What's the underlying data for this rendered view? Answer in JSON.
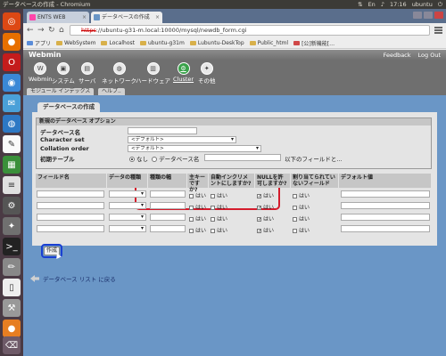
{
  "os": {
    "window_title": "データベースの作成 - Chromium",
    "clock": "17:16",
    "user": "ubuntu"
  },
  "browser": {
    "tabs": [
      {
        "label": "ENTS WEB",
        "active": false
      },
      {
        "label": "データベースの作成",
        "active": true
      }
    ],
    "url_scheme": "https",
    "url_rest": "://ubuntu-g31-m.local:10000/mysql/newdb_form.cgi",
    "bookmarks": [
      "アプリ",
      "WebSystem",
      "Localhost",
      "ubuntu-g31m",
      "Lubuntu-DeskTop",
      "Public_html",
      "[公]新機能[…"
    ]
  },
  "webmin": {
    "title": "Webmin",
    "feedback": "Feedback",
    "logout": "Log Out",
    "categories": [
      "Webmin",
      "システム",
      "サーバ",
      "ネットワーク",
      "ハードウェア",
      "Cluster",
      "その他"
    ],
    "subtabs": [
      "モジュール インデックス",
      "ヘルプ.."
    ]
  },
  "form": {
    "page_tab": "データベースの作成",
    "section_title": "新規のデータベース オプション",
    "dbname_label": "データベース名",
    "charset_label": "Character set",
    "charset_value": "<デフォルト>",
    "collation_label": "Collation order",
    "collation_value": "<デフォルト>",
    "init_table_label": "初期テーブル",
    "init_none": "なし",
    "init_db": "データベース名",
    "init_suffix": "以下のフィールドと..."
  },
  "fields_table": {
    "headers": [
      "フィールド名",
      "データの種類",
      "種類の幅",
      "主キーですか?",
      "自動インクリメントにしますか?",
      "NULLを許可しますか?",
      "割り当てられていないフィールド",
      "デフォルト値"
    ],
    "yes_label": "はい",
    "row_count": 4
  },
  "actions": {
    "create_button": "作成",
    "back_link": "データベース リスト に戻る"
  }
}
